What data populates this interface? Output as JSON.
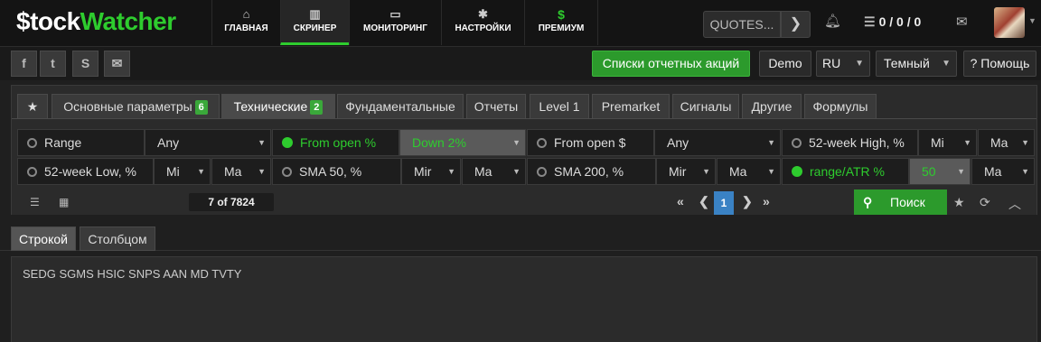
{
  "brand": {
    "dollar": "$",
    "part1": "tock",
    "part2": "Watcher"
  },
  "nav": [
    {
      "label": "ГЛАВНАЯ",
      "icon": "home-icon",
      "glyph": "⌂"
    },
    {
      "label": "СКРИНЕР",
      "icon": "bar-chart-icon",
      "glyph": "▥",
      "active": true
    },
    {
      "label": "МОНИТОРИНГ",
      "icon": "monitor-icon",
      "glyph": "▭"
    },
    {
      "label": "НАСТРОЙКИ",
      "icon": "gear-icon",
      "glyph": "✱"
    },
    {
      "label": "ПРЕМИУМ",
      "icon": "dollar-icon",
      "glyph": "$"
    }
  ],
  "quotes": {
    "label": "QUOTES...",
    "arrow": "❯"
  },
  "counts": {
    "list_glyph": "☰",
    "text": "0 / 0 / 0"
  },
  "social": [
    {
      "icon": "facebook-icon",
      "glyph": "f"
    },
    {
      "icon": "twitter-icon",
      "glyph": "t"
    },
    {
      "icon": "skype-icon",
      "glyph": "S"
    },
    {
      "icon": "email-icon",
      "glyph": "✉"
    }
  ],
  "toolbar": {
    "reports_btn": "Списки отчетных акций",
    "demo_btn": "Demo",
    "lang": "RU",
    "theme": "Темный",
    "help": "? Помощь"
  },
  "filter_tabs": [
    {
      "label": "★",
      "icon": "star-icon"
    },
    {
      "label": "Основные параметры",
      "count": "6"
    },
    {
      "label": "Технические",
      "count": "2",
      "active": true
    },
    {
      "label": "Фундаментальные"
    },
    {
      "label": "Отчеты"
    },
    {
      "label": "Level 1"
    },
    {
      "label": "Premarket"
    },
    {
      "label": "Сигналы"
    },
    {
      "label": "Другие"
    },
    {
      "label": "Формулы"
    }
  ],
  "filters_row1": [
    {
      "label": "Range",
      "on": false,
      "sel1": "Any"
    },
    {
      "label": "From open %",
      "on": true,
      "sel1": "Down 2%"
    },
    {
      "label": "From open $",
      "on": false,
      "sel1": "Any"
    },
    {
      "label": "52-week High, %",
      "on": false,
      "sel1": "Mi",
      "sel2": "Ma"
    }
  ],
  "filters_row2": [
    {
      "label": "52-week Low, %",
      "on": false,
      "sel1": "Mi",
      "sel2": "Ma"
    },
    {
      "label": "SMA 50, %",
      "on": false,
      "sel1": "Mir",
      "sel2": "Ma"
    },
    {
      "label": "SMA 200, %",
      "on": false,
      "sel1": "Mir",
      "sel2": "Ma"
    },
    {
      "label": "range/ATR %",
      "on": true,
      "sel1": "50",
      "sel2": "Ma"
    }
  ],
  "pager": {
    "result_count": "7 of 7824",
    "first": "«",
    "prev": "❮",
    "page": "1",
    "next": "❯",
    "last": "»",
    "search_label": "Поиск",
    "search_glyph": "⚲"
  },
  "result_tabs": [
    {
      "label": "Строкой",
      "active": true
    },
    {
      "label": "Столбцом"
    }
  ],
  "results_text": "SEDG SGMS HSIC SNPS AAN MD TVTY"
}
